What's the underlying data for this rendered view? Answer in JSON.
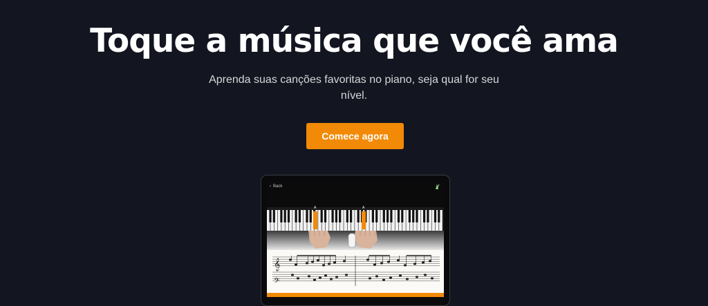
{
  "hero": {
    "title": "Toque a música que você ama",
    "subtitle": "Aprenda suas canções favoritas no piano, seja qual for seu nível.",
    "cta_label": "Comece agora"
  },
  "device": {
    "back_label": "Back",
    "highlighted_key_label": "A"
  },
  "colors": {
    "background": "#131520",
    "accent": "#f28a07",
    "title": "#ffffff",
    "subtitle": "#d6d7dc"
  }
}
